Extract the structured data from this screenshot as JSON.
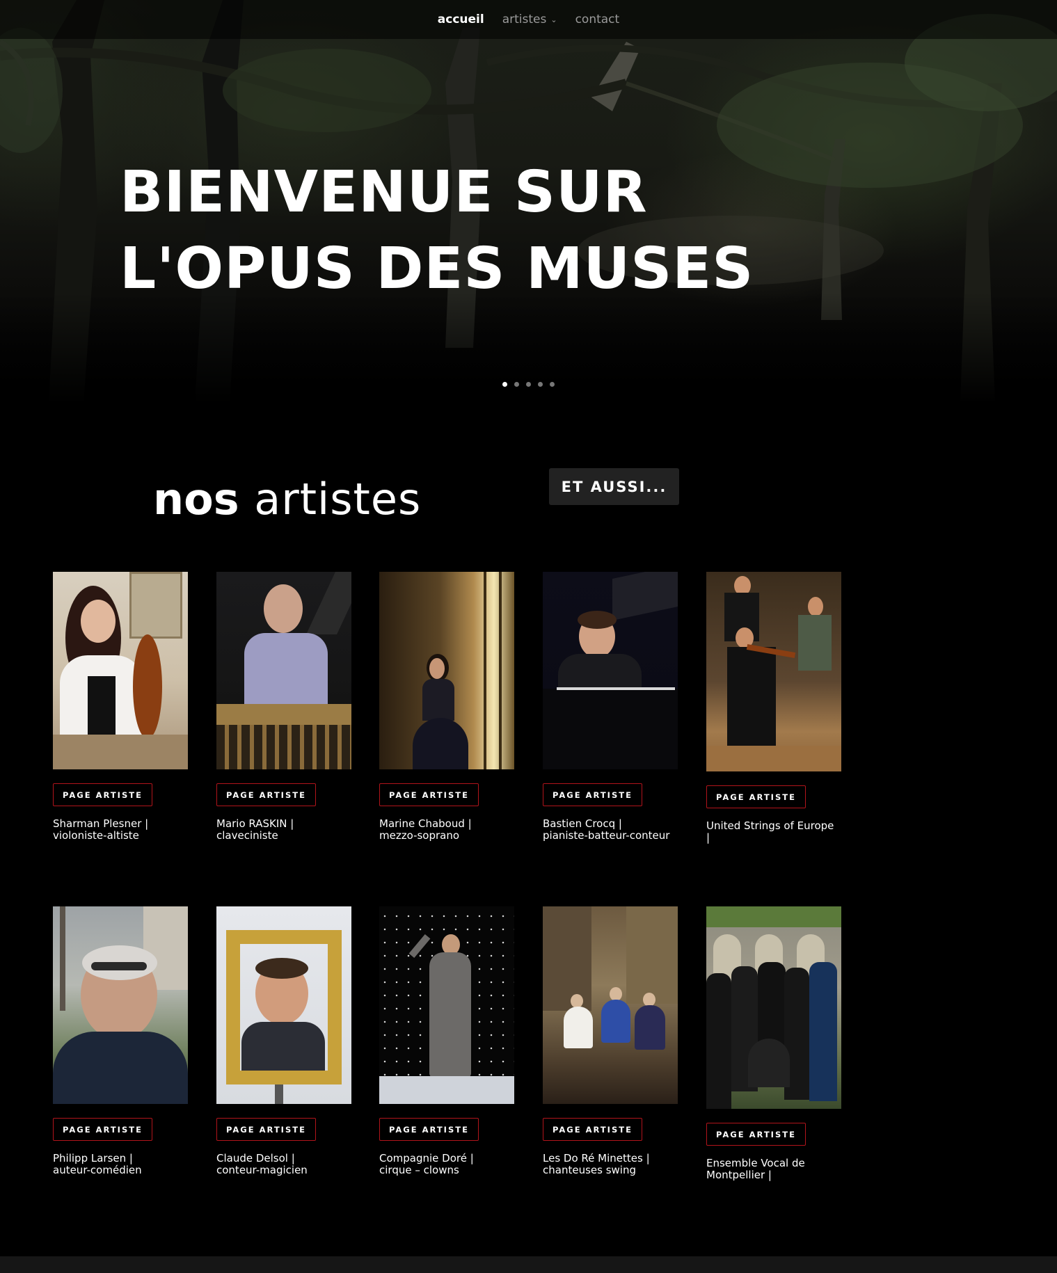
{
  "nav": {
    "items": [
      {
        "label": "accueil",
        "active": true
      },
      {
        "label": "artistes",
        "has_dropdown": true
      },
      {
        "label": "contact"
      }
    ],
    "dropdown_icon": "chevron-down-icon"
  },
  "hero": {
    "title_line1": "BIENVENUE SUR",
    "title_line2": "L'OPUS DES MUSES",
    "slides_count": 5,
    "active_slide": 1
  },
  "section": {
    "title_bold": "nos",
    "title_light": "artistes",
    "aussi_label": "ET AUSSI..."
  },
  "artists": [
    {
      "button": "PAGE ARTISTE",
      "name": "Sharman Plesner |",
      "role": "violoniste-altiste"
    },
    {
      "button": "PAGE ARTISTE",
      "name": "Mario RASKIN |",
      "role": "claveciniste"
    },
    {
      "button": "PAGE ARTISTE",
      "name": "Marine Chaboud |",
      "role": "mezzo-soprano"
    },
    {
      "button": "PAGE ARTISTE",
      "name": "Bastien Crocq |",
      "role": "pianiste-batteur-conteur"
    },
    {
      "button": "PAGE ARTISTE",
      "name": "United Strings of Europe",
      "role": "|"
    },
    {
      "button": "PAGE ARTISTE",
      "name": "Philipp Larsen |",
      "role": "auteur-comédien"
    },
    {
      "button": "PAGE ARTISTE",
      "name": "Claude Delsol |",
      "role": "conteur-magicien"
    },
    {
      "button": "PAGE ARTISTE",
      "name": "Compagnie Doré |",
      "role": "cirque – clowns"
    },
    {
      "button": "PAGE ARTISTE",
      "name": "Les Do Ré Minettes |",
      "role": "chanteuses swing"
    },
    {
      "button": "PAGE ARTISTE",
      "name": "Ensemble Vocal de",
      "role": "Montpellier |"
    }
  ],
  "colors": {
    "background": "#000000",
    "accent_border": "#b2141b",
    "nav_inactive": "#9a9a9a",
    "button_dark": "#222222"
  }
}
